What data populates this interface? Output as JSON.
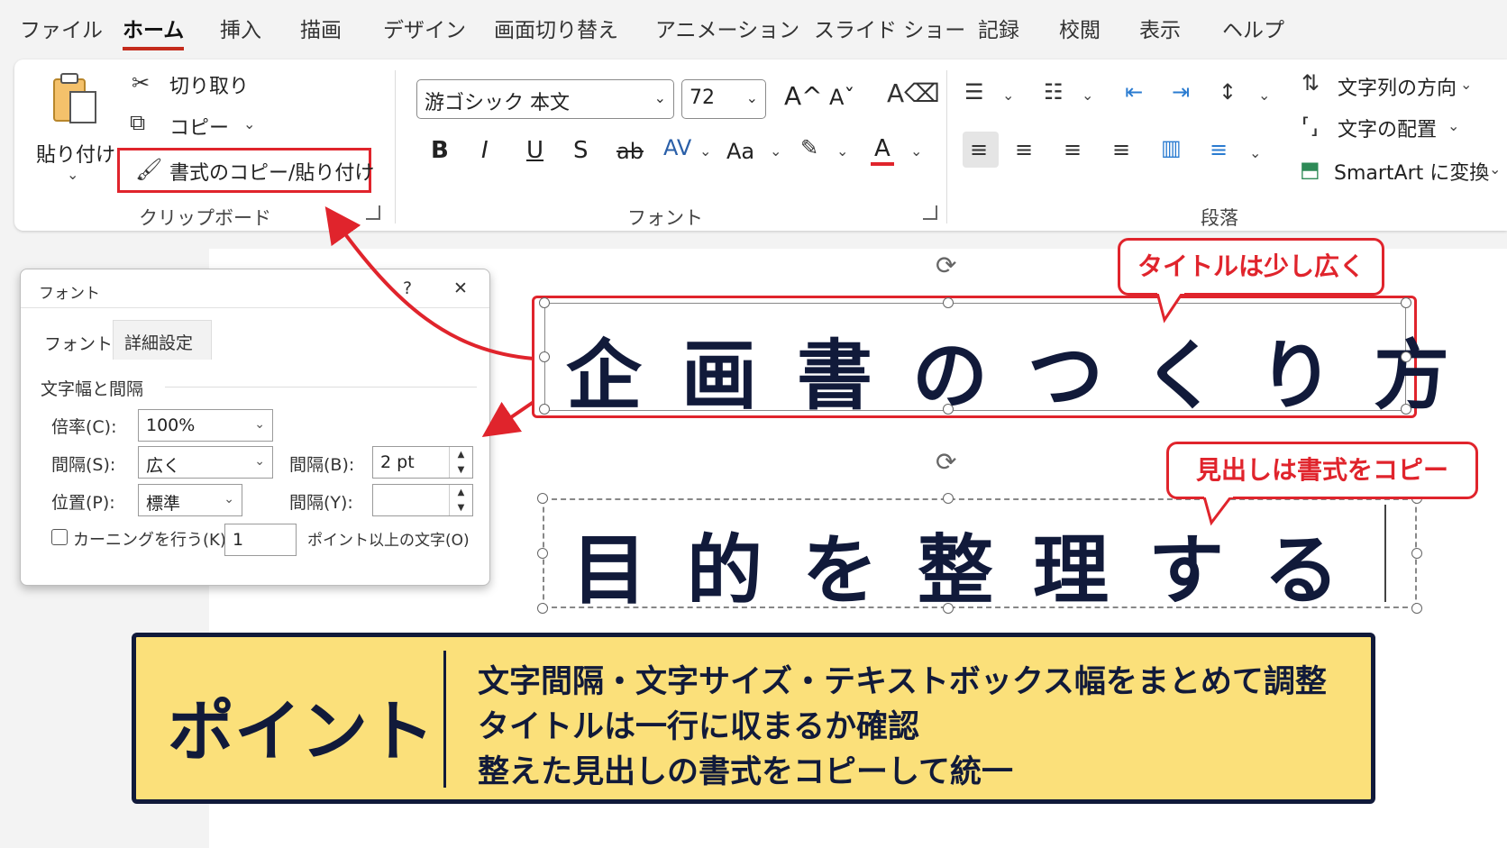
{
  "tabs": [
    "ファイル",
    "ホーム",
    "挿入",
    "描画",
    "デザイン",
    "画面切り替え",
    "アニメーション",
    "スライド ショー",
    "記録",
    "校閲",
    "表示",
    "ヘルプ"
  ],
  "active_tab": "ホーム",
  "clipboard": {
    "paste_label": "貼り付け",
    "cut_label": "切り取り",
    "copy_label": "コピー",
    "format_painter_label": "書式のコピー/貼り付け",
    "group_label": "クリップボード"
  },
  "font_group": {
    "font_name": "游ゴシック 本文",
    "font_size": "72",
    "grow_font": "A^",
    "shrink_font": "Aˇ",
    "bold": "B",
    "italic": "I",
    "underline": "U",
    "shadow": "S",
    "strikethrough": "ab",
    "char_spacing": "AV",
    "change_case": "Aa",
    "font_color": "A",
    "group_label": "フォント"
  },
  "paragraph_group": {
    "text_direction": "文字列の方向",
    "align_text": "文字の配置",
    "smartart": "SmartArt に変換",
    "group_label": "段落"
  },
  "dialog": {
    "title": "フォント",
    "help": "?",
    "close": "✕",
    "tab_font": "フォント",
    "tab_advanced": "詳細設定",
    "section": "文字幅と間隔",
    "scale_label": "倍率(C):",
    "scale_value": "100%",
    "spacing_label": "間隔(S):",
    "spacing_value": "広く",
    "spacing_by_label": "間隔(B):",
    "spacing_by_value": "2 pt",
    "position_label": "位置(P):",
    "position_value": "標準",
    "position_by_label": "間隔(Y):",
    "position_by_value": "",
    "kerning_label": "カーニングを行う(K):",
    "kerning_value": "1",
    "kerning_suffix": "ポイント以上の文字(O)"
  },
  "slide": {
    "title_text": "企画書のつくり方",
    "title_callout": "タイトルは少し広く",
    "subtitle_text": "目的を整理する",
    "subtitle_callout": "見出しは書式をコピー"
  },
  "point": {
    "title": "ポイント",
    "lines": [
      "文字間隔・文字サイズ・テキストボックス幅をまとめて調整",
      "タイトルは一行に収まるか確認",
      "整えた見出しの書式をコピーして統一"
    ]
  },
  "colors": {
    "accent_red": "#e0242c",
    "navy": "#111a3a",
    "point_yellow": "#fbe07a"
  }
}
